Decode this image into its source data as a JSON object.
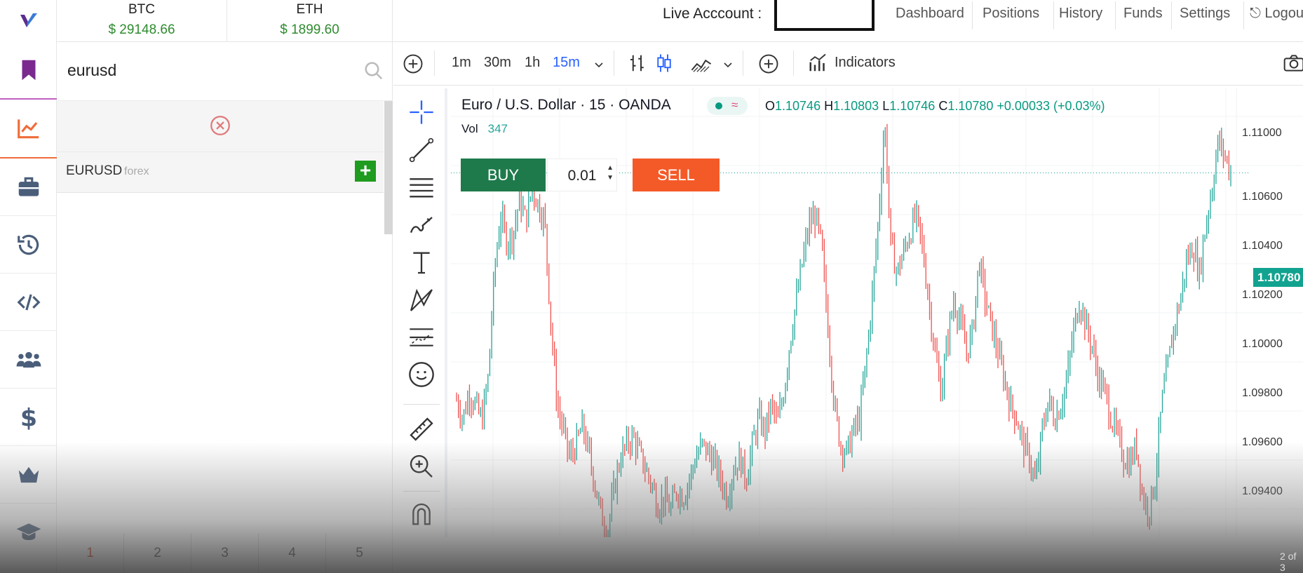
{
  "tickers": [
    {
      "symbol": "BTC",
      "price": "$ 29148.66"
    },
    {
      "symbol": "ETH",
      "price": "$ 1899.60"
    }
  ],
  "topnav": {
    "live_label": "Live Acccount :",
    "links": [
      "Dashboard",
      "Positions",
      "History",
      "Funds",
      "Settings",
      "Logou"
    ]
  },
  "sidebar_icons": [
    "bookmark-icon",
    "chart-line-icon",
    "briefcase-icon",
    "history-icon",
    "code-icon",
    "users-icon",
    "dollar-icon",
    "crown-icon",
    "graduation-cap-icon"
  ],
  "search": {
    "value": "eurusd",
    "result": {
      "symbol": "EURUSD",
      "type": "forex"
    }
  },
  "pager": [
    "1",
    "2",
    "3",
    "4",
    "5"
  ],
  "toolbar": {
    "intervals": [
      "1m",
      "30m",
      "1h",
      "15m"
    ],
    "active_interval": "15m",
    "indicators_label": "Indicators"
  },
  "legend": {
    "title": "Euro / U.S. Dollar · 15 · OANDA",
    "o_label": "O",
    "o": "1.10746",
    "h_label": "H",
    "h": "1.10803",
    "l_label": "L",
    "l": "1.10746",
    "c_label": "C",
    "c": "1.10780",
    "change": "+0.00033 (+0.03%)",
    "vol_label": "Vol",
    "vol": "347"
  },
  "trade": {
    "buy": "BUY",
    "sell": "SELL",
    "qty": "0.01"
  },
  "price_axis": [
    "1.11000",
    "1.10600",
    "1.10400",
    "1.10200",
    "1.10000",
    "1.09800",
    "1.09600",
    "1.09400"
  ],
  "last_price": "1.10780",
  "page_note": "2 of 3",
  "colors": {
    "up": "#26a69a",
    "down": "#ef5350",
    "buy": "#1f7a4b",
    "sell": "#f45a28",
    "accent": "#2962ff"
  },
  "chart_data": {
    "type": "line",
    "title": "Euro / U.S. Dollar · 15 · OANDA",
    "ylim": [
      1.094,
      1.111
    ],
    "series": [
      {
        "name": "EURUSD",
        "values": [
          1.0992,
          1.0985,
          1.0995,
          1.099,
          1.0984,
          1.1,
          1.104,
          1.1062,
          1.1052,
          1.1055,
          1.1068,
          1.106,
          1.1072,
          1.1066,
          1.106,
          1.102,
          1.099,
          1.098,
          1.097,
          1.0975,
          1.0982,
          1.0972,
          1.096,
          1.0948,
          1.0942,
          1.0958,
          1.097,
          1.0975,
          1.0978,
          1.0972,
          1.0966,
          1.096,
          1.0952,
          1.0955,
          1.095,
          1.0958,
          1.0955,
          1.0962,
          1.097,
          1.0975,
          1.0972,
          1.0968,
          1.0962,
          1.0955,
          1.0966,
          1.097,
          1.0962,
          1.0975,
          1.0985,
          1.098,
          1.099,
          1.0983,
          1.0995,
          1.1015,
          1.103,
          1.1045,
          1.1058,
          1.1062,
          1.105,
          1.102,
          1.099,
          1.0975,
          1.0972,
          1.098,
          1.0985,
          1.1005,
          1.103,
          1.106,
          1.1098,
          1.105,
          1.104,
          1.1048,
          1.1055,
          1.1062,
          1.105,
          1.103,
          1.101,
          1.0995,
          1.1015,
          1.103,
          1.1022,
          1.101,
          1.1018,
          1.1045,
          1.103,
          1.102,
          1.101,
          1.1,
          1.099,
          1.0985,
          1.0975,
          1.097,
          1.096,
          1.098,
          1.0992,
          1.0985,
          1.099,
          1.1,
          1.1018,
          1.103,
          1.102,
          1.1012,
          1.1,
          1.0995,
          1.0985,
          1.0978,
          1.097,
          1.0968,
          1.0975,
          1.0955,
          1.095,
          1.0962,
          1.099,
          1.1005,
          1.102,
          1.103,
          1.1045,
          1.105,
          1.104,
          1.1058,
          1.1072,
          1.109,
          1.1085,
          1.1078
        ]
      }
    ]
  }
}
